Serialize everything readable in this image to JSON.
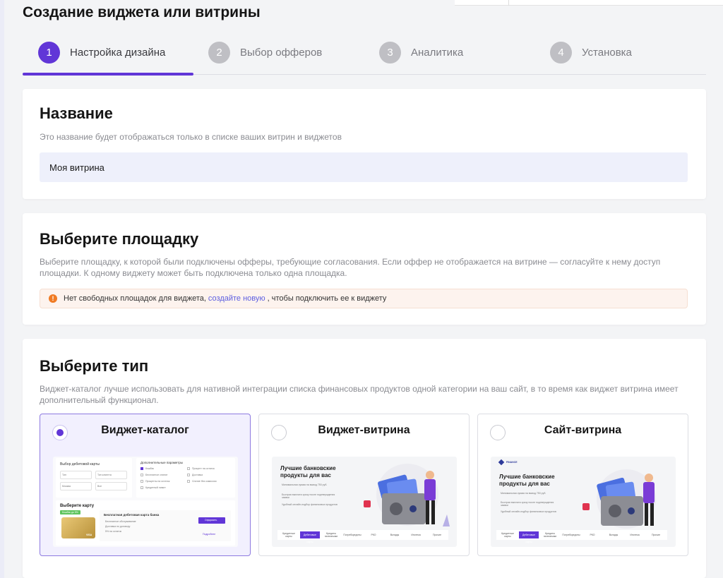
{
  "page": {
    "title": "Создание виджета или витрины"
  },
  "stepper": {
    "steps": [
      {
        "num": "1",
        "label": "Настройка дизайна"
      },
      {
        "num": "2",
        "label": "Выбор офферов"
      },
      {
        "num": "3",
        "label": "Аналитика"
      },
      {
        "num": "4",
        "label": "Установка"
      }
    ],
    "active_step": 1
  },
  "name_section": {
    "title": "Название",
    "description": "Это название будет отображаться только в списке ваших витрин и виджетов",
    "input_value": "Моя витрина"
  },
  "platform_section": {
    "title": "Выберите площадку",
    "description": "Выберите площадку, к которой были подключены офферы, требующие согласования. Если оффер не отображается на витрине — согласуйте к нему доступ площадки. К одному виджету может быть подключена только одна площадка.",
    "alert": {
      "icon": "warning-icon",
      "text_before": "Нет свободных площадок для виджета,",
      "link": "создайте новую",
      "text_after": ", чтобы подключить ее к виджету"
    }
  },
  "type_section": {
    "title": "Выберите тип",
    "description": "Виджет-каталог лучше использовать для нативной интеграции списка финансовых продуктов одной категории на ваш сайт, в то время как виджет витрина имеет дополнительный функционал.",
    "options": [
      {
        "title": "Виджет-каталог",
        "selected": true,
        "preview": {
          "heading": "Выбор дебетовой карты",
          "params_heading": "Дополнительные параметры",
          "field_1": "Тип",
          "field_2": "Тип клиента",
          "field_3": "Москва",
          "field_4": "Все",
          "checkboxes": [
            "Кэшбэк",
            "Бесплатное снятие",
            "Проценты на остаток",
            "Процент на остаток",
            "Доставка",
            "Снятие без комиссии",
            "Кредитный лимит"
          ],
          "pick_label": "Выберите карту",
          "badge": "Кэшбэк до 5%",
          "card_name": "Бесплатная дебетовая карта банка",
          "card_line_1": "Бесплатное обслуживание",
          "card_line_2": "Доставка по договору",
          "card_line_3": "5% на остаток",
          "apply": "Оформить",
          "more": "Подробнее",
          "card_brand": "VISA"
        }
      },
      {
        "title": "Виджет-витрина",
        "selected": false,
        "preview": {
          "heading": "Лучшие банковские продукты для вас",
          "bullets": [
            "Минимальная сумма на вывод 750 руб.",
            "Быстрая выплата сразу после подтверждения заявки",
            "Удобный онлайн-подбор финансовых продуктов"
          ],
          "tabs": [
            "Кредитные карты",
            "Дебетовые карты",
            "Кредиты наличными",
            "Потребкредиты",
            "РКО",
            "Вклады",
            "Ипотека",
            "Прочие"
          ],
          "active_tab": 1
        }
      },
      {
        "title": "Сайт-витрина",
        "selected": false,
        "preview": {
          "logo": "FINANCE",
          "heading": "Лучшие банковские продукты для вас",
          "bullets": [
            "Минимальная сумма на вывод 750 руб.",
            "Быстрая выплата сразу после подтверждения заявки",
            "Удобный онлайн-подбор финансовых продуктов"
          ],
          "tabs": [
            "Кредитные карты",
            "Дебетовые карты",
            "Кредиты наличными",
            "Потребкредиты",
            "РКО",
            "Вклады",
            "Ипотека",
            "Прочие"
          ],
          "active_tab": 1
        }
      }
    ]
  },
  "colors": {
    "accent": "#6136d7",
    "inactive_step": "#bfbfc4",
    "warning": "#f07b24",
    "link": "#5c5ee0"
  }
}
